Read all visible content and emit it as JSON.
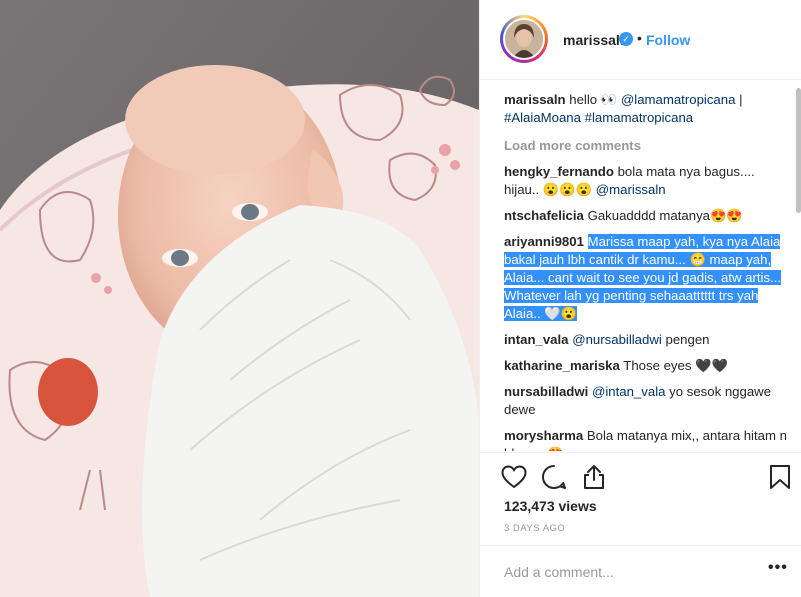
{
  "post": {
    "media_alt": "",
    "header": {
      "username": "marissaln",
      "separator": "•",
      "follow_label": "Follow"
    },
    "caption": {
      "username": "marissaln",
      "text_1": "hello 👀",
      "mention_1": "@lamamatropicana",
      "text_2": "|",
      "hashtag_1": "#AlaiaMoana",
      "hashtag_2": "#lamamatropicana"
    },
    "load_more": "Load more comments",
    "comments": [
      {
        "username": "hengky_fernando",
        "text": "bola mata nya bagus.... hijau.. 😮😮😮",
        "mention": "@marissaln"
      },
      {
        "username": "ntschafelicia",
        "text": "Gakuadddd matanya😍😍"
      },
      {
        "username": "ariyanni9801",
        "text": "Marissa maap yah, kya nya Alaia bakal jauh lbh cantik dr kamu... 😁 maap yah, Alaia... cant wait to see you jd gadis, atw artis... Whatever lah yg penting sehaaatttttt trs yah Alaia.. 🤍😮"
      },
      {
        "username": "intan_vala",
        "mention": "@nursabilladwi",
        "text": "pengen"
      },
      {
        "username": "katharine_mariska",
        "text": "Those eyes 🖤🖤"
      },
      {
        "username": "nursabilladwi",
        "mention": "@intan_vala",
        "text": "yo sesok nggawe dewe"
      },
      {
        "username": "morysharma",
        "text": "Bola matanya mix,, antara hitam n blue,,,, 😍"
      }
    ],
    "actions": {
      "like_icon": "heart-outline-icon",
      "comment_icon": "comment-bubble-icon",
      "share_icon": "share-icon",
      "save_icon": "bookmark-icon"
    },
    "views": "123,473 views",
    "time_ago": "3 DAYS AGO",
    "add_comment_placeholder": "Add a comment...",
    "more_options": "•••"
  },
  "colors": {
    "link": "#3897f0",
    "mention": "#003569",
    "highlight": "#3390ff",
    "muted": "#999999",
    "text": "#262626"
  }
}
